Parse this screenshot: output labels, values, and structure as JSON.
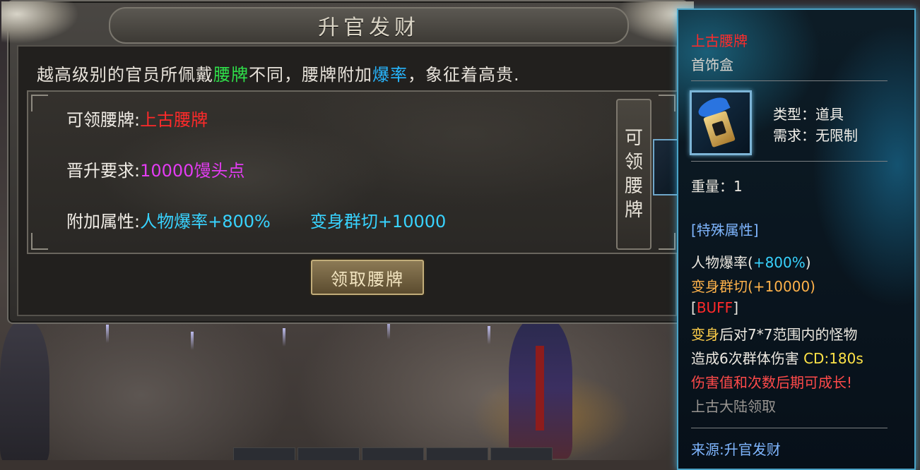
{
  "panel": {
    "title": "升官发财",
    "description": {
      "part1": "越高级别的官员所佩戴",
      "highlight1": "腰牌",
      "part2": "不同，腰牌附加",
      "highlight2": "爆率",
      "part3": "，象征着高贵."
    },
    "rows": {
      "badge_label": "可领腰牌:",
      "badge_value": "上古腰牌",
      "requirement_label": "晋升要求:",
      "requirement_value": "10000馒头点",
      "attr_label": "附加属性:",
      "attr_value1": "人物爆率+800%",
      "attr_value2": "变身群切+10000"
    },
    "vertical_label": [
      "可",
      "领",
      "腰",
      "牌"
    ],
    "claim_button": "领取腰牌"
  },
  "tooltip": {
    "name": "上古腰牌",
    "container": "首饰盒",
    "type_label": "类型：",
    "type_value": "道具",
    "req_label": "需求：",
    "req_value": "无限制",
    "weight_label": "重量：",
    "weight_value": "1",
    "special_header": "[特殊属性]",
    "drop_rate_label": "人物爆率(",
    "drop_rate_value": "+800%",
    "drop_rate_close": ")",
    "transform_label": "变身群切",
    "transform_value": "(+10000)",
    "buff_open": "[",
    "buff_text": "BUFF",
    "buff_close": "]",
    "buff_desc_hl": "变身",
    "buff_desc_rest": "后对7*7范围内的怪物",
    "buff_desc2": "造成6次群体伤害 ",
    "cooldown": "CD:180s",
    "growth": "伤害值和次数后期可成长!",
    "obtain": "上古大陆领取",
    "source": "来源:升官发财"
  },
  "colors": {
    "badge_red": "#ff2a2a",
    "requirement_purple": "#e33cf2",
    "attribute_cyan": "#38d3ff",
    "highlight_green": "#2fe04a",
    "highlight_blue": "#27b6ff",
    "tooltip_border": "#4aa3c7"
  },
  "icons": {
    "item": "waist-badge-icon"
  }
}
